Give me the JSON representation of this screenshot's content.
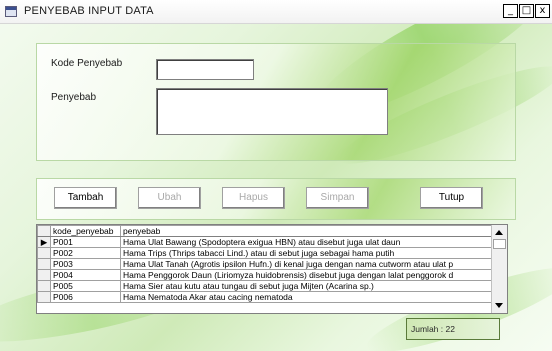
{
  "window": {
    "title": "PENYEBAB INPUT DATA",
    "controls": {
      "minimize": "_",
      "maximize": "□",
      "close": "x"
    }
  },
  "form": {
    "kode_label": "Kode Penyebab",
    "kode_value": "",
    "penyebab_label": "Penyebab",
    "penyebab_value": ""
  },
  "buttons": {
    "tambah": "Tambah",
    "ubah": "Ubah",
    "hapus": "Hapus",
    "simpan": "Simpan",
    "tutup": "Tutup"
  },
  "grid": {
    "columns": [
      "kode_penyebab",
      "penyebab"
    ],
    "rows": [
      [
        "P001",
        "Hama Ulat Bawang (Spodoptera exigua HBN) atau disebut juga ulat daun"
      ],
      [
        "P002",
        "Hama Trips (Thrips tabacci Lind.) atau di sebut juga sebagai hama putih"
      ],
      [
        "P003",
        "Hama Ulat Tanah (Agrotis ipsilon Hufn.) di kenal juga dengan nama cutworm atau ulat p"
      ],
      [
        "P004",
        "Hama Penggorok Daun (Liriomyza huidobrensis) disebut juga dengan lalat penggorok d"
      ],
      [
        "P005",
        "Hama Sier atau kutu atau tungau di sebut juga Mijten (Acarina sp.)"
      ],
      [
        "P006",
        "Hama Nematoda Akar atau cacing nematoda"
      ]
    ],
    "selected_row": 0,
    "row_indicator": "▶"
  },
  "status": {
    "jumlah": "Jumlah : 22"
  },
  "colors": {
    "accent_green": "#a5d76e",
    "panel_border": "#b9d8a5"
  }
}
